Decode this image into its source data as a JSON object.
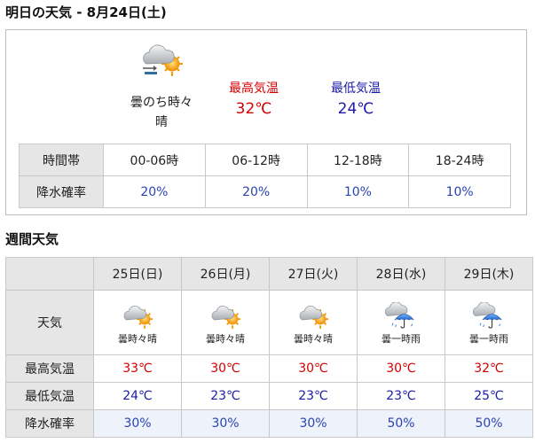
{
  "tomorrow": {
    "title": "明日の天気 - 8月24日(土)",
    "icon": "cloudy-then-sunny-icon",
    "condition_line1": "曇のち時々",
    "condition_line2": "晴",
    "max_label": "最高気温",
    "max_value": "32℃",
    "min_label": "最低気温",
    "min_value": "24℃",
    "row_headers": {
      "time": "時間帯",
      "precip": "降水確率"
    },
    "periods": [
      {
        "time": "00-06時",
        "precip": "20%"
      },
      {
        "time": "06-12時",
        "precip": "20%"
      },
      {
        "time": "12-18時",
        "precip": "10%"
      },
      {
        "time": "18-24時",
        "precip": "10%"
      }
    ]
  },
  "weekly": {
    "title": "週間天気",
    "row_headers": {
      "weather": "天気",
      "max": "最高気温",
      "min": "最低気温",
      "precip": "降水確率"
    },
    "days": [
      {
        "date": "25日(日)",
        "icon": "cloud-sun-icon",
        "condition": "曇時々晴",
        "max": "33℃",
        "min": "24℃",
        "precip": "30%"
      },
      {
        "date": "26日(月)",
        "icon": "cloud-sun-icon",
        "condition": "曇時々晴",
        "max": "30℃",
        "min": "23℃",
        "precip": "30%"
      },
      {
        "date": "27日(火)",
        "icon": "cloud-sun-icon",
        "condition": "曇時々晴",
        "max": "30℃",
        "min": "23℃",
        "precip": "30%"
      },
      {
        "date": "28日(水)",
        "icon": "cloud-umbrella-icon",
        "condition": "曇一時雨",
        "max": "30℃",
        "min": "23℃",
        "precip": "50%"
      },
      {
        "date": "29日(木)",
        "icon": "cloud-umbrella-icon",
        "condition": "曇一時雨",
        "max": "32℃",
        "min": "25℃",
        "precip": "50%"
      }
    ]
  },
  "colors": {
    "max_temp": "#d40000",
    "min_temp": "#1a1aa6",
    "header_bg": "#e6e6e6",
    "precip_row_bg": "#eef2fb"
  }
}
